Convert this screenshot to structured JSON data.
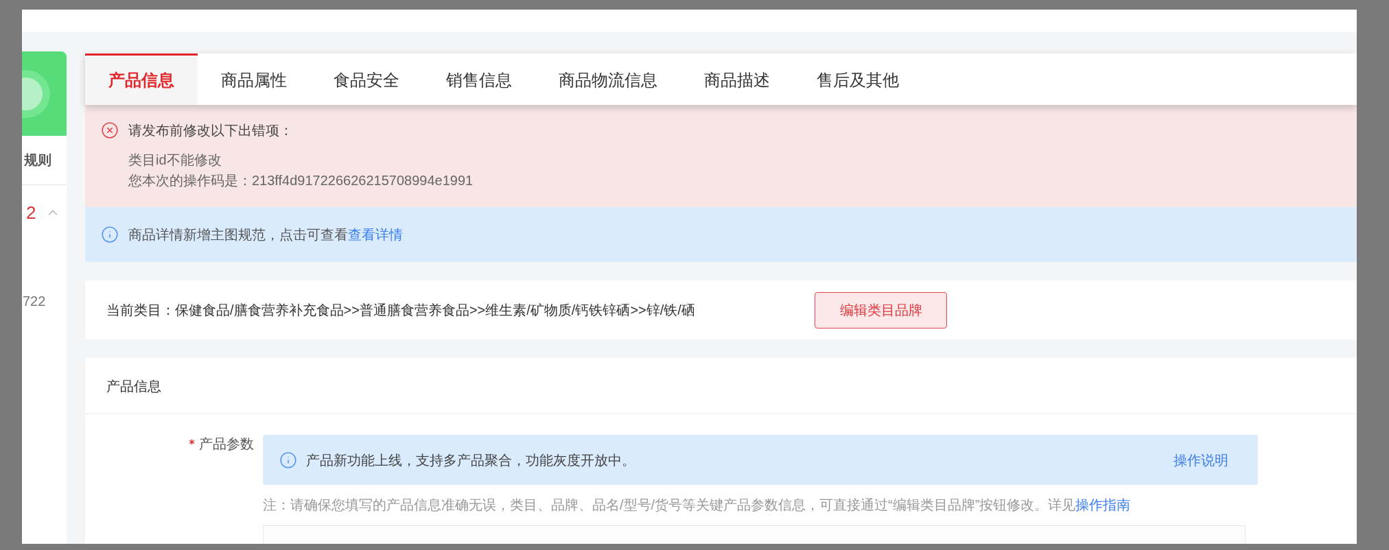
{
  "sidebar": {
    "heading": "规则",
    "count": "2",
    "expanded": true,
    "number": "722"
  },
  "tabs": [
    {
      "label": "产品信息",
      "selected": true
    },
    {
      "label": "商品属性",
      "selected": false
    },
    {
      "label": "食品安全",
      "selected": false
    },
    {
      "label": "销售信息",
      "selected": false
    },
    {
      "label": "商品物流信息",
      "selected": false
    },
    {
      "label": "商品描述",
      "selected": false
    },
    {
      "label": "售后及其他",
      "selected": false
    }
  ],
  "error_alert": {
    "title": "请发布前修改以下出错项：",
    "lines": [
      "类目id不能修改",
      "您本次的操作码是：213ff4d917226626215708994e1991"
    ]
  },
  "info_alert": {
    "text": "商品详情新增主图规范，点击可查看",
    "link": "查看详情"
  },
  "category": {
    "text": "当前类目：保健食品/膳食营养补充食品>>普通膳食营养食品>>维生素/矿物质/钙铁锌硒>>锌/铁/硒",
    "button": "编辑类目品牌"
  },
  "product_info": {
    "title": "产品信息",
    "field": {
      "label": "产品参数",
      "required": true,
      "notice": {
        "text": "产品新功能上线，支持多产品聚合，功能灰度开放中。",
        "link": "操作说明"
      },
      "note": {
        "text": "注：请确保您填写的产品信息准确无误，类目、品牌、品名/型号/货号等关键产品参数信息，可直接通过“编辑类目品牌”按钮修改。详见",
        "link": "操作指南"
      }
    }
  }
}
